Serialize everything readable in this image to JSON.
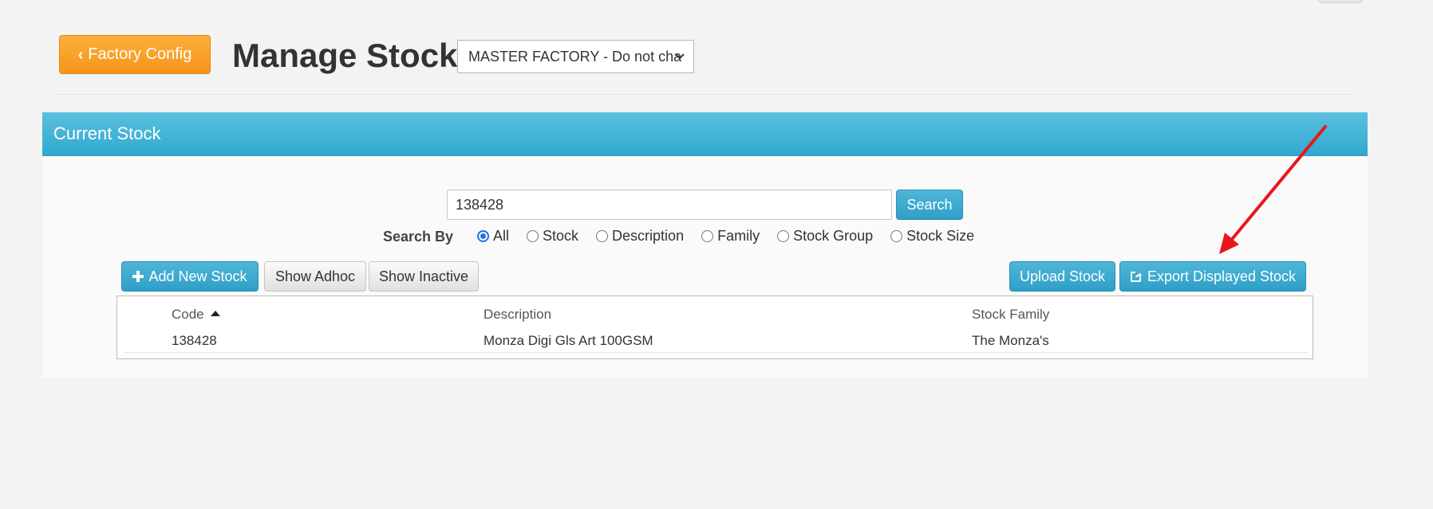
{
  "header": {
    "back_label": "Factory Config",
    "title": "Manage Stock",
    "factory_select": "MASTER FACTORY - Do not cha"
  },
  "panel": {
    "title": "Current Stock",
    "search_value": "138428",
    "search_label": "Search",
    "search_by_label": "Search By",
    "search_by_options": [
      {
        "label": "All",
        "checked": true
      },
      {
        "label": "Stock",
        "checked": false
      },
      {
        "label": "Description",
        "checked": false
      },
      {
        "label": "Family",
        "checked": false
      },
      {
        "label": "Stock Group",
        "checked": false
      },
      {
        "label": "Stock Size",
        "checked": false
      }
    ],
    "buttons": {
      "add_new": "Add New Stock",
      "show_adhoc": "Show Adhoc",
      "show_inactive": "Show Inactive",
      "upload": "Upload Stock",
      "export": "Export Displayed Stock"
    }
  },
  "table": {
    "columns": [
      "Code",
      "Description",
      "Stock Family"
    ],
    "sorted_column": "Code",
    "sort_direction": "ascending",
    "rows": [
      {
        "code": "138428",
        "description": "Monza Digi Gls Art 100GSM",
        "family": "The Monza's"
      }
    ]
  },
  "colors": {
    "primary_info": "#31a9cf",
    "warning": "#f7941d",
    "annotation_arrow": "#e8161b"
  },
  "icons": [
    "chevron-left-icon",
    "chevron-down-icon",
    "plus-icon",
    "export-icon",
    "sort-up-icon"
  ]
}
